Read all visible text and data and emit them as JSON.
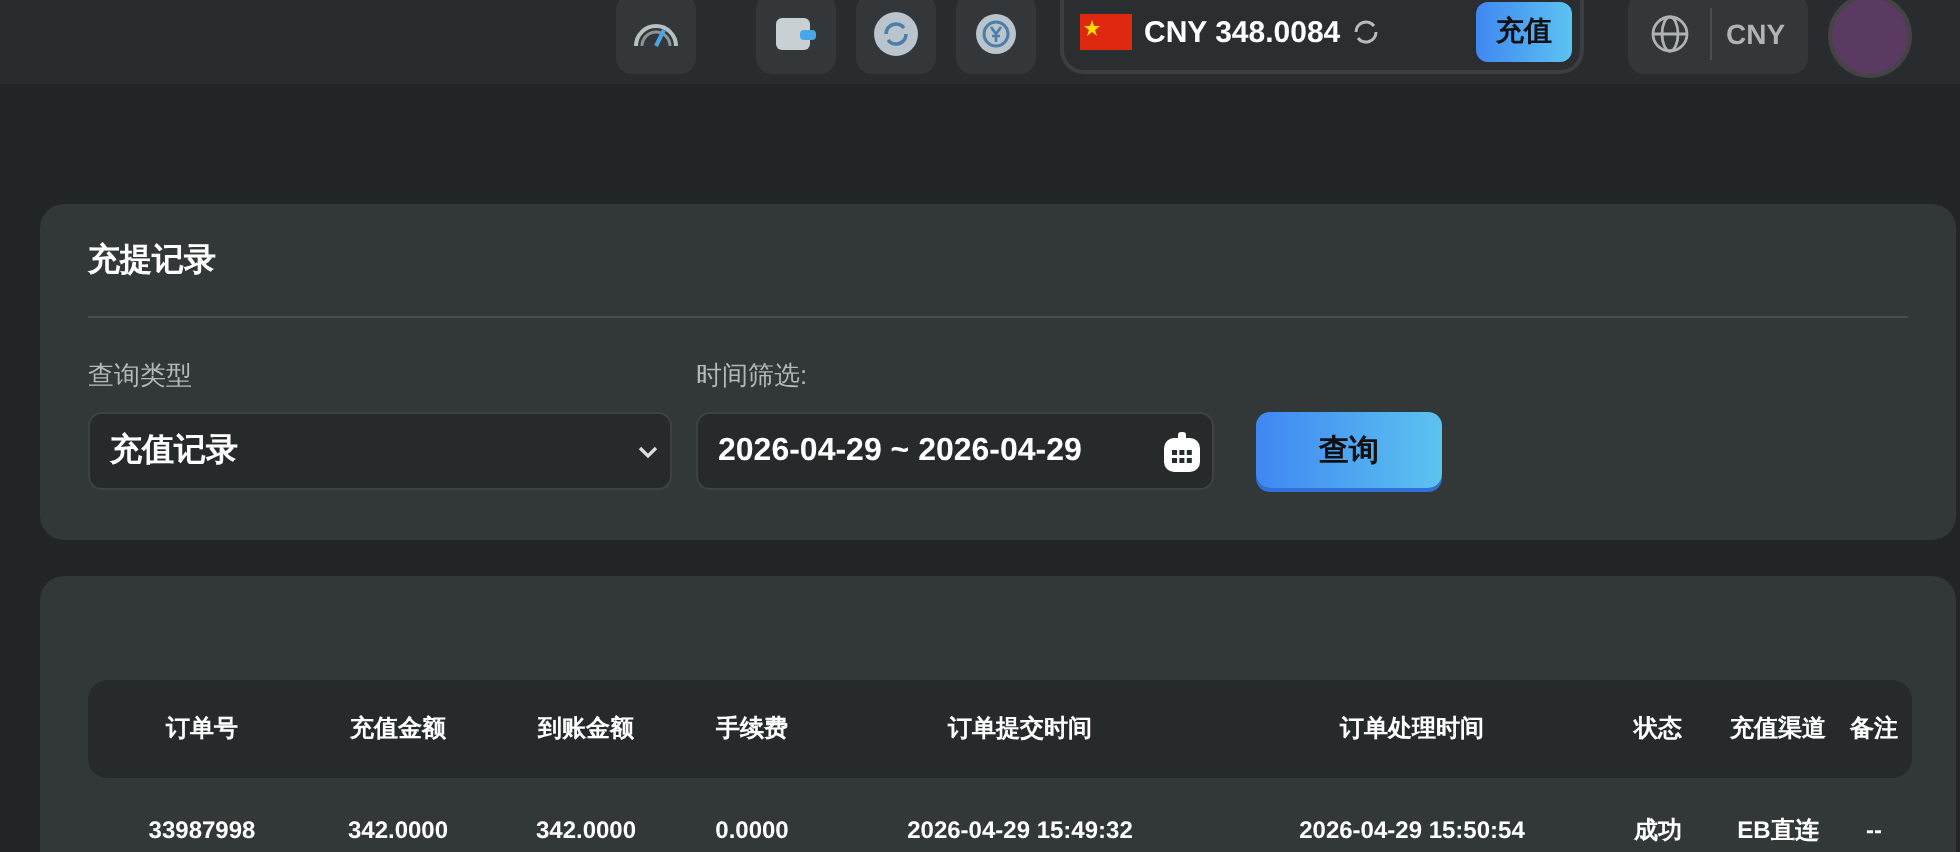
{
  "top_bar": {
    "balance": {
      "currency": "CNY",
      "amount": "348.0084"
    },
    "recharge_button": "充值",
    "currency_selector": "CNY"
  },
  "filter_card": {
    "title": "充提记录",
    "query_type": {
      "label": "查询类型",
      "value": "充值记录"
    },
    "time_filter": {
      "label": "时间筛选:",
      "value": "2026-04-29 ~ 2026-04-29"
    },
    "search_button": "查询"
  },
  "table": {
    "columns": [
      "订单号",
      "充值金额",
      "到账金额",
      "手续费",
      "订单提交时间",
      "订单处理时间",
      "状态",
      "充值渠道",
      "备注"
    ],
    "rows": [
      [
        "33987998",
        "342.0000",
        "342.0000",
        "0.0000",
        "2026-04-29 15:49:32",
        "2026-04-29 15:50:54",
        "成功",
        "EB直连",
        "--"
      ]
    ]
  }
}
